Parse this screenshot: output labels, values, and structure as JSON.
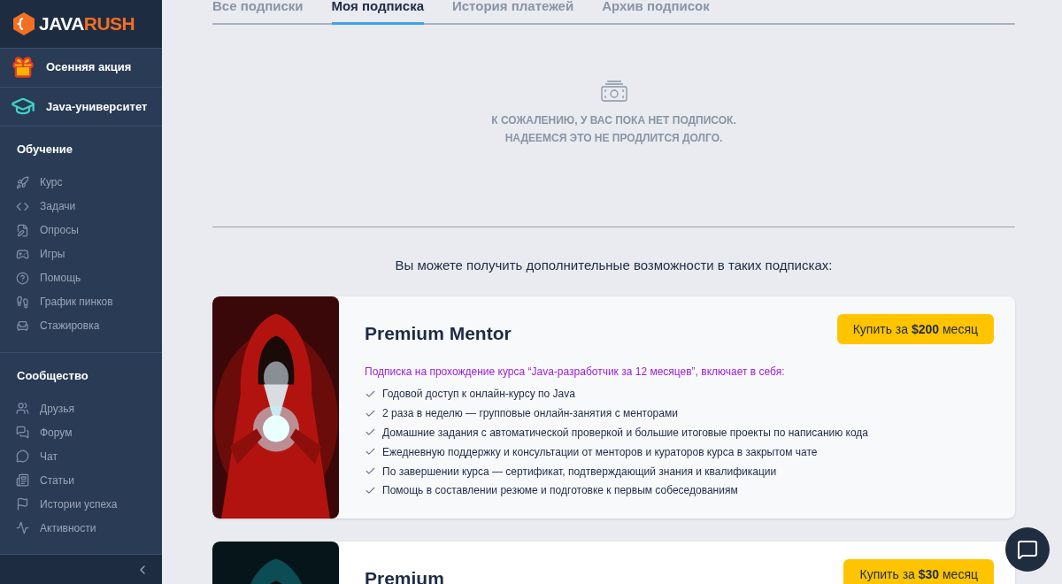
{
  "logo": {
    "part_1": "JAVA",
    "part_2": "RUSH"
  },
  "sidebar": {
    "promos": [
      {
        "kind": "gift",
        "label": "Осенняя акция"
      },
      {
        "kind": "cap",
        "label": "Java-университет"
      }
    ],
    "sections": [
      {
        "title": "Обучение",
        "items": [
          {
            "kind": "rocket",
            "label": "Курс"
          },
          {
            "kind": "code",
            "label": "Задачи"
          },
          {
            "kind": "edit",
            "label": "Опросы"
          },
          {
            "kind": "game",
            "label": "Игры"
          },
          {
            "kind": "help",
            "label": "Помощь"
          },
          {
            "kind": "shoe",
            "label": "График пинков"
          },
          {
            "kind": "chair",
            "label": "Стажировка"
          }
        ]
      },
      {
        "title": "Сообщество",
        "items": [
          {
            "kind": "users",
            "label": "Друзья"
          },
          {
            "kind": "forum",
            "label": "Форум"
          },
          {
            "kind": "chat",
            "label": "Чат"
          },
          {
            "kind": "news",
            "label": "Статьи"
          },
          {
            "kind": "flag",
            "label": "Истории успеха"
          },
          {
            "kind": "activity",
            "label": "Активности"
          }
        ]
      }
    ]
  },
  "tabs": [
    {
      "label": "Все подписки",
      "selected": false
    },
    {
      "label": "Моя подписка",
      "selected": true
    },
    {
      "label": "История платежей",
      "selected": false
    },
    {
      "label": "Архив подписок",
      "selected": false
    }
  ],
  "empty_state": {
    "lines": [
      "К СОЖАЛЕНИЮ, У ВАС ПОКА НЕТ ПОДПИСОК.",
      "НАДЕЕМСЯ ЭТО НЕ ПРОДЛИТСЯ ДОЛГО."
    ]
  },
  "offers_heading": "Вы можете получить дополнительные возможности в таких подписках:",
  "plans": [
    {
      "kind": "red",
      "title": "Premium Mentor",
      "button": "Купить за **$200** месяц",
      "intro": "Подписка на прохождение курса “Java-разработчик за 12 месяцев”, включает в себя:",
      "features": [
        "Годовой доступ к онлайн-курсу по Java",
        "2 раза в неделю — групповые онлайн-занятия с менторами",
        "Домашние задания с автоматической проверкой и большие итоговые проекты по написанию кода",
        "Ежедневную поддержку и консультации от менторов и кураторов курса в закрытом чате",
        "По завершении курса — сертификат, подтверждающий знания и квалификации",
        "Помощь в составлении резюме и подготовке к первым собеседованиям"
      ]
    },
    {
      "kind": "teal",
      "title": "Premium",
      "button": "Купить за **$30** месяц"
    }
  ]
}
